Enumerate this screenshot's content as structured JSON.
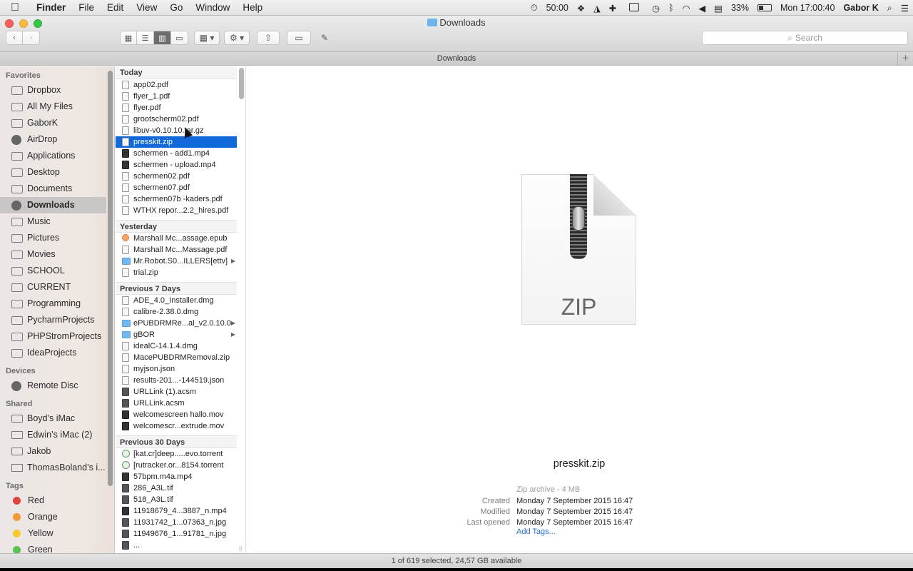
{
  "menubar": {
    "app": "Finder",
    "menus": [
      "File",
      "Edit",
      "View",
      "Go",
      "Window",
      "Help"
    ],
    "timer": "50:00",
    "battery": "33%",
    "clock": "Mon 17:00:40",
    "user": "Gabor K"
  },
  "window": {
    "title": "Downloads",
    "path_title": "Downloads",
    "search_placeholder": "Search"
  },
  "sidebar": {
    "favorites_label": "Favorites",
    "favorites": [
      {
        "label": "Dropbox",
        "icon": "dropbox-icon"
      },
      {
        "label": "All My Files",
        "icon": "all-files-icon"
      },
      {
        "label": "GaborK",
        "icon": "home-icon"
      },
      {
        "label": "AirDrop",
        "icon": "airdrop-icon"
      },
      {
        "label": "Applications",
        "icon": "applications-icon"
      },
      {
        "label": "Desktop",
        "icon": "desktop-icon"
      },
      {
        "label": "Documents",
        "icon": "documents-icon"
      },
      {
        "label": "Downloads",
        "icon": "downloads-icon",
        "active": true
      },
      {
        "label": "Music",
        "icon": "music-icon"
      },
      {
        "label": "Pictures",
        "icon": "pictures-icon"
      },
      {
        "label": "Movies",
        "icon": "movies-icon"
      },
      {
        "label": "SCHOOL",
        "icon": "folder-icon"
      },
      {
        "label": "CURRENT",
        "icon": "folder-icon"
      },
      {
        "label": "Programming",
        "icon": "folder-icon"
      },
      {
        "label": "PycharmProjects",
        "icon": "folder-icon"
      },
      {
        "label": "PHPStromProjects",
        "icon": "folder-icon"
      },
      {
        "label": "IdeaProjects",
        "icon": "folder-icon"
      }
    ],
    "devices_label": "Devices",
    "devices": [
      {
        "label": "Remote Disc",
        "icon": "disc-icon"
      }
    ],
    "shared_label": "Shared",
    "shared": [
      {
        "label": "Boyd’s iMac",
        "icon": "monitor-icon"
      },
      {
        "label": "Edwin’s iMac (2)",
        "icon": "monitor-icon"
      },
      {
        "label": "Jakob",
        "icon": "monitor-icon"
      },
      {
        "label": "ThomasBoland’s i...",
        "icon": "monitor-icon"
      }
    ],
    "tags_label": "Tags",
    "tags": [
      {
        "label": "Red",
        "color": "#e0443e"
      },
      {
        "label": "Orange",
        "color": "#f29a35"
      },
      {
        "label": "Yellow",
        "color": "#f5c932"
      },
      {
        "label": "Green",
        "color": "#5cc155"
      }
    ]
  },
  "column": {
    "groups": [
      {
        "label": "Today",
        "files": [
          {
            "name": "app02.pdf",
            "icon": "doc"
          },
          {
            "name": "flyer_1.pdf",
            "icon": "doc"
          },
          {
            "name": "flyer.pdf",
            "icon": "doc"
          },
          {
            "name": "grootscherm02.pdf",
            "icon": "doc"
          },
          {
            "name": "libuv-v0.10.10.tar.gz",
            "icon": "doc"
          },
          {
            "name": "presskit.zip",
            "icon": "doc",
            "selected": true
          },
          {
            "name": "schermen - add1.mp4",
            "icon": "video"
          },
          {
            "name": "schermen - upload.mp4",
            "icon": "video"
          },
          {
            "name": "schermen02.pdf",
            "icon": "doc"
          },
          {
            "name": "schermen07.pdf",
            "icon": "doc"
          },
          {
            "name": "schermen07b -kaders.pdf",
            "icon": "doc"
          },
          {
            "name": "WTHX repor...2.2_hires.pdf",
            "icon": "doc"
          }
        ]
      },
      {
        "label": "Yesterday",
        "files": [
          {
            "name": "Marshall Mc...assage.epub",
            "icon": "epub"
          },
          {
            "name": "Marshall Mc...Massage.pdf",
            "icon": "doc"
          },
          {
            "name": "Mr.Robot.S0...ILLERS[ettv]",
            "icon": "folder",
            "arrow": true
          },
          {
            "name": "trial.zip",
            "icon": "doc"
          }
        ]
      },
      {
        "label": "Previous 7 Days",
        "files": [
          {
            "name": "ADE_4.0_Installer.dmg",
            "icon": "doc"
          },
          {
            "name": "calibre-2.38.0.dmg",
            "icon": "doc"
          },
          {
            "name": "ePUBDRMRe...al_v2.0.10.0",
            "icon": "folder",
            "arrow": true
          },
          {
            "name": "gBOR",
            "icon": "folder",
            "arrow": true
          },
          {
            "name": "idealC-14.1.4.dmg",
            "icon": "doc"
          },
          {
            "name": "MacePUBDRMRemoval.zip",
            "icon": "doc"
          },
          {
            "name": "myjson.json",
            "icon": "doc"
          },
          {
            "name": "results-201...-144519.json",
            "icon": "doc"
          },
          {
            "name": "URLLink (1).acsm",
            "icon": "img"
          },
          {
            "name": "URLLink.acsm",
            "icon": "img"
          },
          {
            "name": "welcomescreen hallo.mov",
            "icon": "video"
          },
          {
            "name": "welcomescr...extrude.mov",
            "icon": "video"
          }
        ]
      },
      {
        "label": "Previous 30 Days",
        "files": [
          {
            "name": "[kat.cr]deep.....evo.torrent",
            "icon": "torrent"
          },
          {
            "name": "[rutracker.or...8154.torrent",
            "icon": "torrent"
          },
          {
            "name": "57bpm.m4a.mp4",
            "icon": "video"
          },
          {
            "name": "286_A3L.tif",
            "icon": "img"
          },
          {
            "name": "518_A3L.tif",
            "icon": "img"
          },
          {
            "name": "11918679_4...3887_n.mp4",
            "icon": "video"
          },
          {
            "name": "11931742_1...07363_n.jpg",
            "icon": "img"
          },
          {
            "name": "11949676_1...91781_n.jpg",
            "icon": "img"
          },
          {
            "name": "...",
            "icon": "img"
          }
        ]
      }
    ]
  },
  "preview": {
    "zip_label": "ZIP",
    "name": "presskit.zip",
    "kind": "Zip archive - 4 MB",
    "created_label": "Created",
    "created": "Monday 7 September 2015 16:47",
    "modified_label": "Modified",
    "modified": "Monday 7 September 2015 16:47",
    "opened_label": "Last opened",
    "opened": "Monday 7 September 2015 16:47",
    "add_tags": "Add Tags..."
  },
  "status": "1 of 619 selected, 24,57 GB available"
}
